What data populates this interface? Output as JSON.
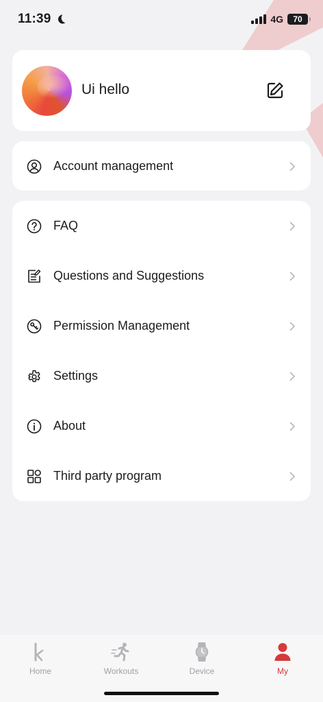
{
  "status_bar": {
    "time": "11:39",
    "network": "4G",
    "battery": "70"
  },
  "profile": {
    "name": "Ui hello"
  },
  "account": {
    "label": "Account management"
  },
  "menu": [
    {
      "label": "FAQ",
      "icon": "help-circle-icon"
    },
    {
      "label": "Questions and Suggestions",
      "icon": "feedback-note-icon"
    },
    {
      "label": "Permission Management",
      "icon": "permission-icon"
    },
    {
      "label": "Settings",
      "icon": "gear-icon"
    },
    {
      "label": "About",
      "icon": "info-icon"
    },
    {
      "label": "Third party program",
      "icon": "grid-apps-icon"
    }
  ],
  "tabs": [
    {
      "label": "Home",
      "icon": "home-k-icon",
      "active": false
    },
    {
      "label": "Workouts",
      "icon": "running-icon",
      "active": false
    },
    {
      "label": "Device",
      "icon": "watch-icon",
      "active": false
    },
    {
      "label": "My",
      "icon": "person-icon",
      "active": true
    }
  ],
  "colors": {
    "accent": "#d63a3a",
    "inactive_tab": "#a0a0a4",
    "background": "#f2f2f4",
    "card": "#ffffff",
    "stripe": "#efc5c7"
  }
}
